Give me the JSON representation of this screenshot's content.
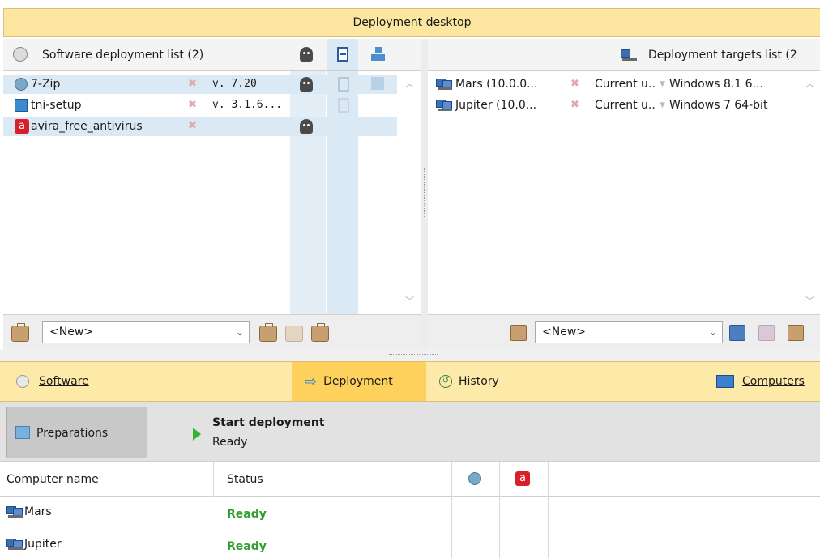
{
  "title": "Deployment desktop",
  "software_panel": {
    "header": "Software deployment list (2)",
    "items": [
      {
        "name": "7-Zip",
        "version": "v. 7.20"
      },
      {
        "name": "tni-setup",
        "version": "v. 3.1.6..."
      },
      {
        "name": "avira_free_antivirus",
        "version": ""
      }
    ],
    "combo_value": "<New>",
    "icons": [
      "ghost-icon",
      "film-icon",
      "boxes-icon",
      "x-mark-icon",
      "cd-icon",
      "briefcase-icon"
    ]
  },
  "targets_panel": {
    "header": "Deployment targets list (2",
    "items": [
      {
        "name": "Mars (10.0.0...",
        "user": "Current u..",
        "os": "Windows 8.1 6..."
      },
      {
        "name": "Jupiter (10.0...",
        "user": "Current u..",
        "os": "Windows 7 64-bit"
      }
    ],
    "combo_value": "<New>"
  },
  "tabs": {
    "software": "Software",
    "deployment": "Deployment",
    "history": "History",
    "computers": "Computers"
  },
  "deploy": {
    "preparations": "Preparations",
    "start": "Start deployment",
    "status": "Ready"
  },
  "grid": {
    "columns": [
      "Computer name",
      "Status"
    ],
    "rows": [
      {
        "name": "Mars",
        "status": "Ready"
      },
      {
        "name": "Jupiter",
        "status": "Ready"
      }
    ]
  },
  "colors": {
    "accent_yellow": "#fde6a0",
    "active_tab": "#fdd15c",
    "selection": "#dbe9f4",
    "ready_green": "#2e9e2e"
  }
}
